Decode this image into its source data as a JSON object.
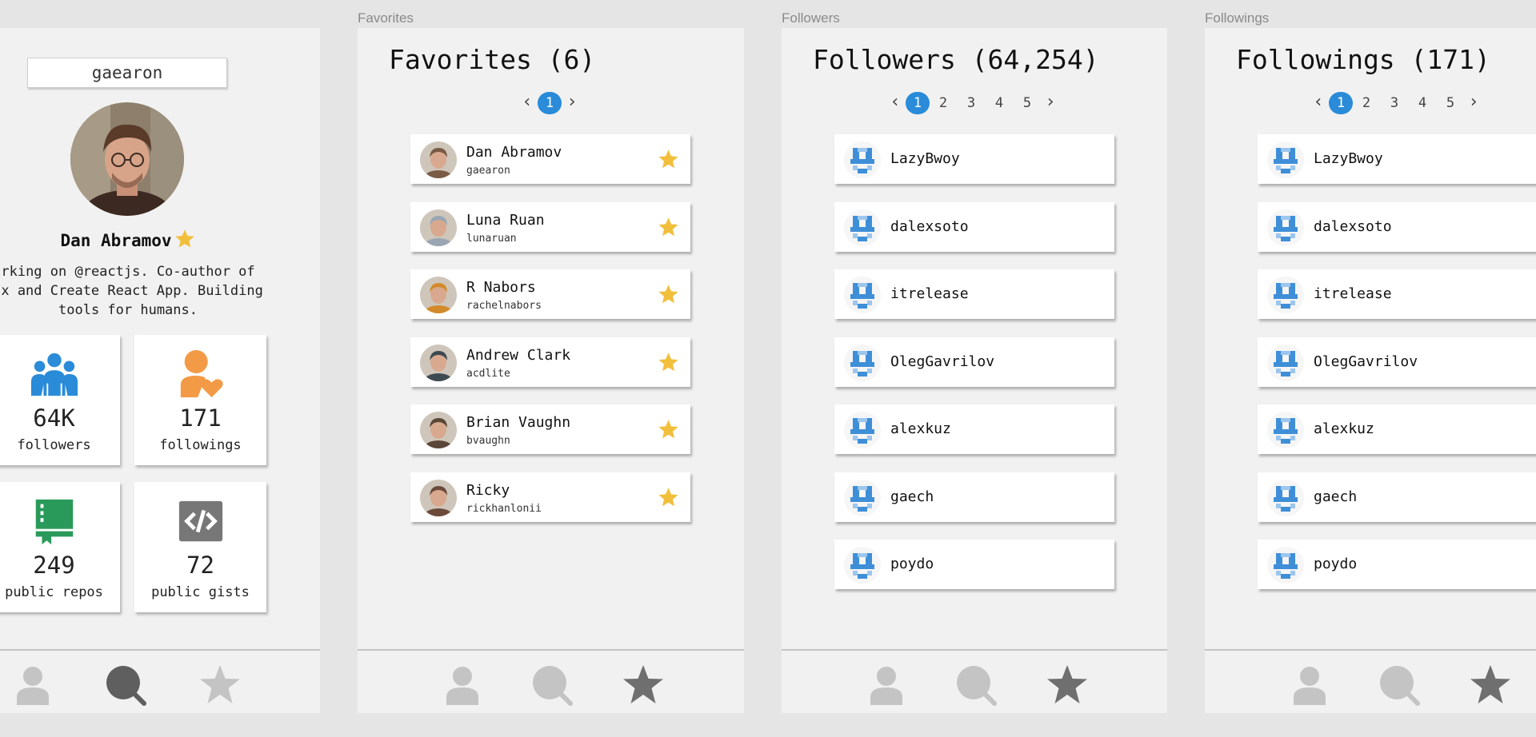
{
  "frame_labels": {
    "favorites": "Favorites",
    "followers": "Followers",
    "followings": "Followings"
  },
  "colors": {
    "accent_blue": "#2a8bd8",
    "star_gold": "#f2bf3c",
    "orange": "#f39a46",
    "green": "#2a9a5a",
    "gray": "#777777",
    "nav_inactive": "#c4c4c4",
    "nav_active": "#7a7a7a"
  },
  "profile": {
    "username": "gaearon",
    "name": "Dan Abramov",
    "bio": [
      "rking on @reactjs. Co-author of",
      "ux and Create React App. Building",
      "tools for humans."
    ],
    "stats": [
      {
        "icon": "followers-icon",
        "value": "64K",
        "label": "followers"
      },
      {
        "icon": "followings-icon",
        "value": "171",
        "label": "followings"
      },
      {
        "icon": "repo-book-icon",
        "value": "249",
        "label": "public repos"
      },
      {
        "icon": "code-icon",
        "value": "72",
        "label": "public gists"
      }
    ],
    "nav_active": "search"
  },
  "favorites": {
    "title": "Favorites (6)",
    "pager": {
      "prev": "‹",
      "pages": [
        "1"
      ],
      "current": "1",
      "next": "›"
    },
    "users": [
      {
        "name": "Dan Abramov",
        "login": "gaearon",
        "avatar_color": "#7a5a44"
      },
      {
        "name": "Luna Ruan",
        "login": "lunaruan",
        "avatar_color": "#9aa6b4"
      },
      {
        "name": "R Nabors",
        "login": "rachelnabors",
        "avatar_color": "#d38a2a"
      },
      {
        "name": "Andrew Clark",
        "login": "acdlite",
        "avatar_color": "#3e4a52"
      },
      {
        "name": "Brian Vaughn",
        "login": "bvaughn",
        "avatar_color": "#5a4636"
      },
      {
        "name": "Ricky",
        "login": "rickhanlonii",
        "avatar_color": "#6b4a3a"
      }
    ],
    "nav_active": "favorites"
  },
  "followers": {
    "title": "Followers (64,254)",
    "pager": {
      "prev": "‹",
      "pages": [
        "1",
        "2",
        "3",
        "4",
        "5"
      ],
      "current": "1",
      "next": "›"
    },
    "users": [
      "LazyBwoy",
      "dalexsoto",
      "itrelease",
      "OlegGavrilov",
      "alexkuz",
      "gaech",
      "poydo"
    ],
    "nav_active": "favorites"
  },
  "followings": {
    "title": "Followings (171)",
    "pager": {
      "prev": "‹",
      "pages": [
        "1",
        "2",
        "3",
        "4",
        "5"
      ],
      "current": "1",
      "next": "›"
    },
    "users": [
      "LazyBwoy",
      "dalexsoto",
      "itrelease",
      "OlegGavrilov",
      "alexkuz",
      "gaech",
      "poydo"
    ],
    "nav_active": "favorites"
  }
}
